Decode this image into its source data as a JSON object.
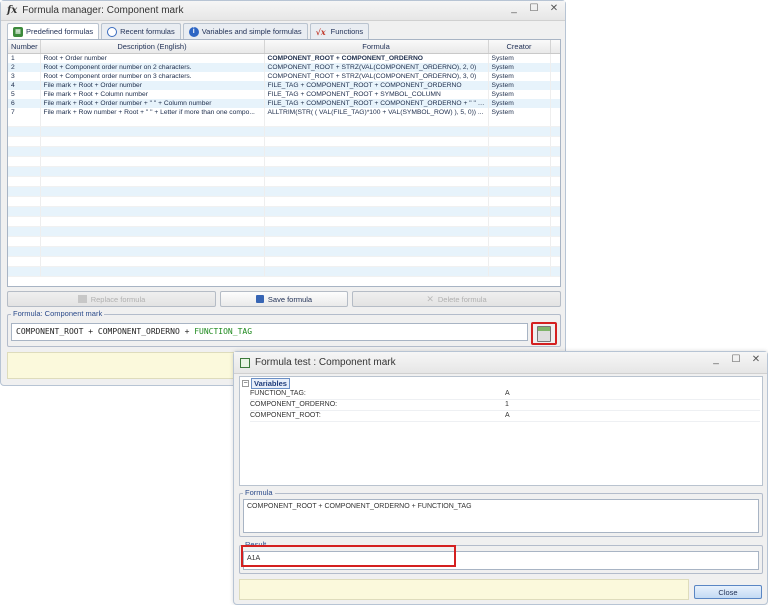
{
  "main_window": {
    "title": "Formula manager: Component mark",
    "controls": [
      "_",
      "☐",
      "✕"
    ],
    "tabs": [
      {
        "label": "Predefined formulas",
        "icon": "grid-icon",
        "active": true
      },
      {
        "label": "Recent formulas",
        "icon": "clock-icon"
      },
      {
        "label": "Variables and simple formulas",
        "icon": "info-icon"
      },
      {
        "label": "Functions",
        "icon": "fx-icon"
      }
    ],
    "table": {
      "columns": [
        "Number",
        "Description (English)",
        "Formula",
        "Creator"
      ],
      "rows": [
        {
          "number": "1",
          "description": "Root + Order number",
          "formula": "COMPONENT_ROOT + COMPONENT_ORDERNO",
          "creator": "System"
        },
        {
          "number": "2",
          "description": "Root + Component order number on 2 characters.",
          "formula": "COMPONENT_ROOT + STRZ(VAL(COMPONENT_ORDERNO), 2, 0)",
          "creator": "System"
        },
        {
          "number": "3",
          "description": "Root + Component order number on 3 characters.",
          "formula": "COMPONENT_ROOT + STRZ(VAL(COMPONENT_ORDERNO), 3, 0)",
          "creator": "System"
        },
        {
          "number": "4",
          "description": "File mark + Root + Order number",
          "formula": "FILE_TAG + COMPONENT_ROOT + COMPONENT_ORDERNO",
          "creator": "System"
        },
        {
          "number": "5",
          "description": "File mark + Root + Column number",
          "formula": "FILE_TAG + COMPONENT_ROOT + SYMBOL_COLUMN",
          "creator": "System"
        },
        {
          "number": "6",
          "description": "File mark + Root + Order number + \" \" + Column number",
          "formula": "FILE_TAG + COMPONENT_ROOT + COMPONENT_ORDERNO + \" \" + S...",
          "creator": "System"
        },
        {
          "number": "7",
          "description": "File mark + Row number + Root + \" \" + Letter if more than one compo...",
          "formula": "ALLTRIM(STR( ( VAL(FILE_TAG)*100 + VAL(SYMBOL_ROW) ), 5, 0)) ...",
          "creator": "System"
        }
      ]
    },
    "buttons": {
      "replace": "Replace formula",
      "save": "Save formula",
      "delete": "Delete formula"
    },
    "formula_group": {
      "legend": "Formula: Component mark",
      "value_black": "COMPONENT_ROOT + COMPONENT_ORDERNO + ",
      "value_green": "FUNCTION_TAG"
    }
  },
  "test_window": {
    "title": "Formula test : Component mark",
    "controls": [
      "_",
      "☐",
      "✕"
    ],
    "variables": {
      "title": "Variables",
      "items": [
        {
          "name": "FUNCTION_TAG:",
          "value": "A"
        },
        {
          "name": "COMPONENT_ORDERNO:",
          "value": "1"
        },
        {
          "name": "COMPONENT_ROOT:",
          "value": "A"
        }
      ]
    },
    "formula": {
      "legend": "Formula",
      "value": "COMPONENT_ROOT + COMPONENT_ORDERNO + FUNCTION_TAG"
    },
    "result": {
      "legend": "Result",
      "value": "A1A"
    },
    "close_label": "Close"
  },
  "colors": {
    "highlight_red": "#d42020",
    "row_alt": "#e7f3fb",
    "info_strip": "#fbf9dc",
    "formula_green": "#1e8a1e"
  }
}
